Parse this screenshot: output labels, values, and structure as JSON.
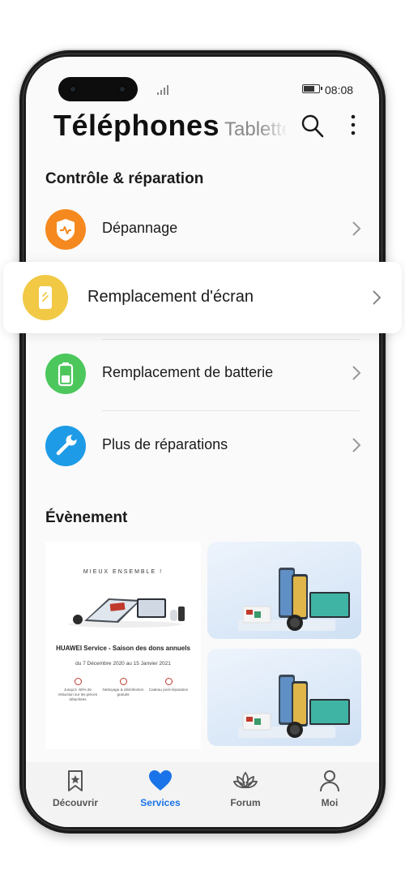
{
  "status_bar": {
    "time": "08:08",
    "battery_level": 0.75
  },
  "tabs": {
    "active": "Téléphones",
    "next": "Tablettes"
  },
  "sections": {
    "repair": {
      "title": "Contrôle & réparation",
      "items": [
        {
          "label": "Dépannage",
          "icon": "shield-icon",
          "color": "#f5891f"
        },
        {
          "label": "Remplacement d'écran",
          "icon": "phone-screen-icon",
          "color": "#f1c945"
        },
        {
          "label": "Remplacement de batterie",
          "icon": "battery-icon",
          "color": "#4cc75c"
        },
        {
          "label": "Plus de réparations",
          "icon": "wrench-icon",
          "color": "#1e9be6"
        }
      ]
    },
    "event": {
      "title": "Évènement",
      "banner": {
        "headline": "MIEUX ENSEMBLE !",
        "title": "HUAWEI Service - Saison des dons annuels",
        "dates": "du 7 Décembre 2020 au 15 Janvier 2021",
        "perks": [
          "Jusqu'à -50% de réduction sur les pièces détachées",
          "Nettoyage & désinfection gratuits",
          "Cadeau post-réparation"
        ]
      }
    }
  },
  "bottom_nav": [
    {
      "label": "Découvrir",
      "icon": "bookmark-star-icon"
    },
    {
      "label": "Services",
      "icon": "heart-icon",
      "active": true
    },
    {
      "label": "Forum",
      "icon": "lotus-icon"
    },
    {
      "label": "Moi",
      "icon": "user-icon"
    }
  ],
  "colors": {
    "accent": "#1a73e8",
    "nav_inactive": "#555555"
  }
}
